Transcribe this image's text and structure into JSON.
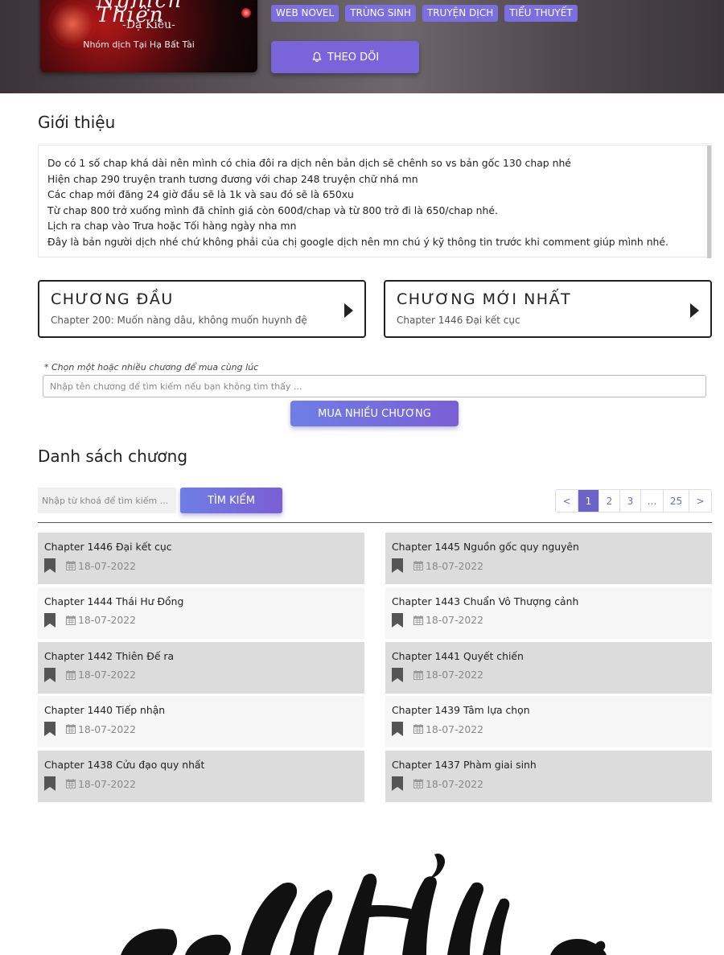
{
  "header": {
    "cover": {
      "title_art": "Nghịch Thiên",
      "author": "-Dạ Kiêu-",
      "group": "Nhóm dịch Tại Hạ Bất Tài"
    },
    "tags": [
      "WEB NOVEL",
      "TRÙNG SINH",
      "TRUYỆN DỊCH",
      "TIỂU THUYẾT"
    ],
    "follow_label": "THEO DÕI",
    "follow_icon": "bell-icon"
  },
  "intro": {
    "title": "Giới thiệu",
    "lines": [
      "Do có 1 số chap khá dài nên mình có chia đôi ra dịch nên bản dịch sẽ chênh so vs bản gốc 130 chap nhé",
      "Hiện chap 290 truyện tranh tương đương với chap 248 truyện chữ nhá mn",
      "Các chap mới đăng 24 giờ đầu sẽ là 1k và sau đó sẽ là 650xu",
      "Từ  chap 800 trở xuống mình đã chỉnh giá còn 600đ/chap và từ 800 trở đi là 650/chap nhé.",
      "Lịch ra chap vào Trưa hoặc Tối hàng ngày nha mn",
      "Đây là bản người dịch nhé chứ không phải của chị google dịch nên mn chú ý kỹ thông tin trước khi comment giúp mình nhé."
    ]
  },
  "first_chapter": {
    "label": "CHƯƠNG ĐẦU",
    "chapter": "Chapter 200: Muốn nàng dâu, không muốn huynh đệ"
  },
  "latest_chapter": {
    "label": "CHƯƠNG MỚI NHẤT",
    "chapter": "Chapter 1446 Đại kết cục"
  },
  "multi_buy": {
    "hint": "* Chọn một hoặc nhiều chương để mua cùng lúc",
    "search_placeholder": "Nhập tên chương để tìm kiếm nếu bạn không tìm thấy ...",
    "button_label": "MUA NHIỀU CHƯƠNG"
  },
  "chapter_list": {
    "title": "Danh sách chương",
    "keyword_placeholder": "Nhập từ khoá để tìm kiếm ...",
    "search_label": "TÌM KIẾM",
    "pagination": {
      "prev": "<",
      "pages": [
        "1",
        "2",
        "3",
        "...",
        "25"
      ],
      "current": "1",
      "next": ">"
    },
    "chapters": [
      {
        "name": "Chapter 1446 Đại kết cục",
        "date": "18-07-2022"
      },
      {
        "name": "Chapter 1445 Nguồn gốc quy nguyên",
        "date": "18-07-2022"
      },
      {
        "name": "Chapter 1444 Thái Hư Đồng",
        "date": "18-07-2022"
      },
      {
        "name": "Chapter 1443 Chuẩn Vô Thượng cảnh",
        "date": "18-07-2022"
      },
      {
        "name": "Chapter 1442 Thiên Đế ra",
        "date": "18-07-2022"
      },
      {
        "name": "Chapter 1441 Quyết chiến",
        "date": "18-07-2022"
      },
      {
        "name": "Chapter 1440 Tiếp nhận",
        "date": "18-07-2022"
      },
      {
        "name": "Chapter 1439 Tâm lựa chọn",
        "date": "18-07-2022"
      },
      {
        "name": "Chapter 1438 Cửu đạo quy nhất",
        "date": "18-07-2022"
      },
      {
        "name": "Chapter 1437 Phàm giai sinh",
        "date": "18-07-2022"
      }
    ],
    "icons": {
      "bookmark": "bookmark-icon",
      "date": "calendar-icon"
    }
  },
  "colors": {
    "accent": "#7a64d9",
    "tag": "#7a6ee0",
    "pager_active": "#6c63c9",
    "row_shade": "#dcdcdc",
    "row_light": "#f6f6f6"
  }
}
